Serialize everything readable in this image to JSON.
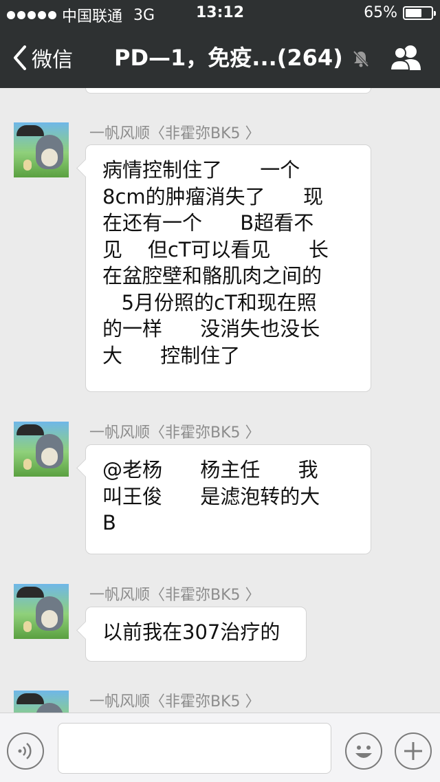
{
  "status_bar": {
    "carrier": "中国联通",
    "network": "3G",
    "time": "13:12",
    "battery_percent": "65%",
    "battery_level": 0.65
  },
  "nav": {
    "back_label": "微信",
    "title": "PD—1，免疫...(264)",
    "icons": [
      "back-chevron-icon",
      "mute-bell-icon",
      "group-members-icon"
    ]
  },
  "messages": [
    {
      "sender": "一帆风顺〈非霍弥BK5 〉",
      "text": "病情控制住了      一个\n8cm的肿瘤消失了      现\n在还有一个      B超看不\n见    但cT可以看见      长\n在盆腔壁和骼肌肉之间的\n   5月份照的cT和现在照\n的一样      没消失也没长\n大      控制住了"
    },
    {
      "sender": "一帆风顺〈非霍弥BK5 〉",
      "text": "@老杨      杨主任      我\n叫王俊      是滤泡转的大\nB"
    },
    {
      "sender": "一帆风顺〈非霍弥BK5 〉",
      "text": "以前我在307治疗的"
    },
    {
      "sender": "一帆风顺〈非霍弥BK5 〉",
      "text": ""
    }
  ],
  "input_bar": {
    "icons": [
      "voice-icon",
      "emoji-icon",
      "plus-icon"
    ],
    "placeholder": ""
  }
}
